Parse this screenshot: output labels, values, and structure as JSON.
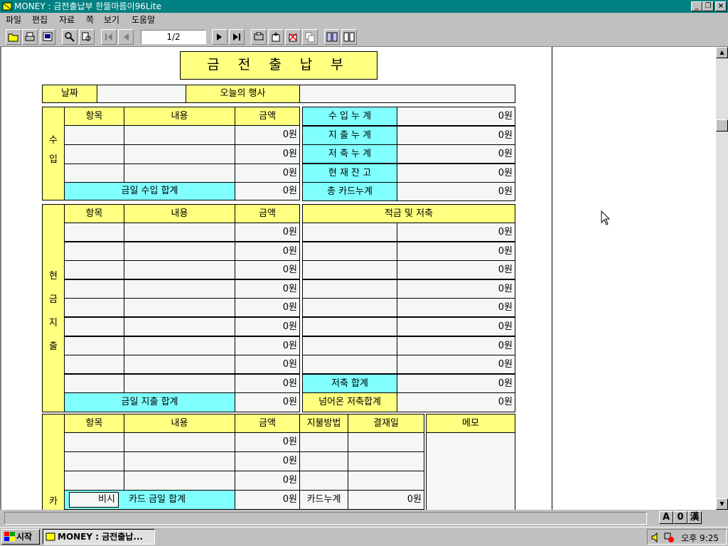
{
  "window": {
    "title": "MONEY : 금전출납부   한뜰마름이96Lite"
  },
  "menu": [
    "파일",
    "편집",
    "자료",
    "쪽",
    "보기",
    "도움말"
  ],
  "toolbar": {
    "page_indicator": "1/2"
  },
  "form": {
    "title": "금 전 출 납 부",
    "date_label": "날짜",
    "event_label": "오늘의 행사",
    "col_item": "항목",
    "col_content": "내용",
    "col_amount": "금액",
    "income": {
      "side": [
        "수",
        "입"
      ],
      "amounts": [
        "0원",
        "0원",
        "0원"
      ],
      "total_label": "금일 수입 합계",
      "total_value": "0원"
    },
    "cumulative": [
      {
        "label": "수 입 누 계",
        "value": "0원"
      },
      {
        "label": "지 출 누 계",
        "value": "0원"
      },
      {
        "label": "저 축 누 계",
        "value": "0원"
      },
      {
        "label": "현 재 잔 고",
        "value": "0원"
      },
      {
        "label": "총 카드누계",
        "value": "0원"
      }
    ],
    "cash": {
      "side": [
        "현",
        "금",
        "지",
        "출"
      ],
      "amounts": [
        "0원",
        "0원",
        "0원",
        "0원",
        "0원",
        "0원",
        "0원",
        "0원",
        "0원"
      ],
      "total_label": "금일 지출 합계",
      "total_value": "0원"
    },
    "savings": {
      "header": "적금 및 저축",
      "amounts": [
        "0원",
        "0원",
        "0원",
        "0원",
        "0원",
        "0원",
        "0원",
        "0원"
      ],
      "total_label": "저축 합계",
      "total_value": "0원",
      "carry_label": "넘어온 저축합계",
      "carry_value": "0원"
    },
    "card": {
      "side": [
        "카"
      ],
      "col_payment": "지불방법",
      "col_settle": "결재일",
      "amounts": [
        "0원",
        "0원",
        "0원"
      ],
      "fee_label": "비시",
      "total_label": "카드 금일 합계",
      "total_value": "0원",
      "cum_label": "카드누계",
      "cum_value": "0원"
    },
    "memo_label": "메모"
  },
  "statusbar": {
    "ime": [
      "A",
      "0",
      "漢"
    ]
  },
  "taskbar": {
    "start": "시작",
    "task": "MONEY : 금전출납...",
    "clock": "오후 9:25"
  },
  "colors": {
    "title_bar": "#008080",
    "yellow": "#ffff80",
    "cyan": "#80ffff"
  }
}
